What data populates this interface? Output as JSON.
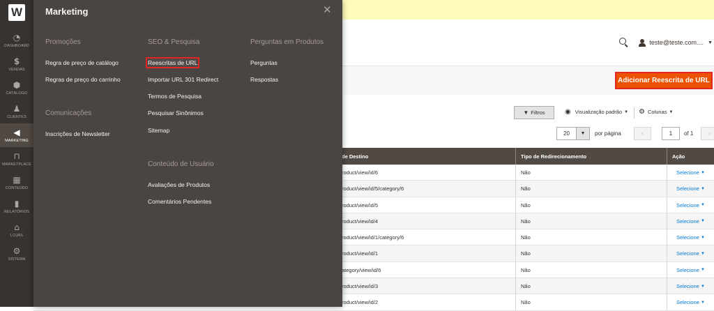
{
  "rail": {
    "items": [
      {
        "label": "DASHBOARD",
        "icon": "dashboard-icon"
      },
      {
        "label": "VENDAS",
        "icon": "dollar-icon"
      },
      {
        "label": "CATÁLOGO",
        "icon": "box-icon"
      },
      {
        "label": "CLIENTES",
        "icon": "person-icon"
      },
      {
        "label": "MARKETING",
        "icon": "megaphone-icon"
      },
      {
        "label": "MARKETPLACE",
        "icon": "store-icon"
      },
      {
        "label": "CONTEÚDO",
        "icon": "layout-icon"
      },
      {
        "label": "RELATÓRIOS",
        "icon": "bar-chart-icon"
      },
      {
        "label": "LOJAS",
        "icon": "storefront-icon"
      },
      {
        "label": "SISTEMA",
        "icon": "gear-icon"
      }
    ],
    "logo": "W",
    "active_index": 4
  },
  "flyout": {
    "title": "Marketing",
    "groups": [
      {
        "title": "Promoções",
        "links": [
          "Regra de preço de catálogo",
          "Regras de preço do carrinho"
        ]
      },
      {
        "title": "Comunicações",
        "links": [
          "Inscrições de Newsletter"
        ]
      },
      {
        "title": "SEO & Pesquisa",
        "links": [
          "Reescritas de URL",
          "Importar URL 301 Redirect",
          "Termos de Pesquisa",
          "Pesquisar Sinônimos",
          "Sitemap"
        ]
      },
      {
        "title": "Conteúdo de Usuário",
        "links": [
          "Avaliações de Produtos",
          "Comentários Pendentes"
        ]
      },
      {
        "title": "Perguntas em Produtos",
        "links": [
          "Perguntas",
          "Respostas"
        ]
      }
    ]
  },
  "header": {
    "user": "teste@teste.com...."
  },
  "actions": {
    "add_button": "Adicionar Reescrita de URL"
  },
  "toolbar": {
    "filters": "Filtros",
    "view": "Visualização padrão",
    "columns": "Colunas"
  },
  "pager": {
    "per_page_value": "20",
    "per_page_label": "por página",
    "current_page": "1",
    "of_pages": "of 1"
  },
  "grid": {
    "columns": [
      "de Destino",
      "Tipo de Redirecionamento",
      "Ação"
    ],
    "rows": [
      [
        "roduct/view/id/6",
        "Não",
        "Selecione"
      ],
      [
        "roduct/view/id/5/category/6",
        "Não",
        "Selecione"
      ],
      [
        "roduct/view/id/5",
        "Não",
        "Selecione"
      ],
      [
        "roduct/view/id/4",
        "Não",
        "Selecione"
      ],
      [
        "roduct/view/id/1/category/6",
        "Não",
        "Selecione"
      ],
      [
        "roduct/view/id/1",
        "Não",
        "Selecione"
      ],
      [
        "ategory/view/id/6",
        "Não",
        "Selecione"
      ],
      [
        "roduct/view/id/3",
        "Não",
        "Selecione"
      ],
      [
        "roduct/view/id/2",
        "Não",
        "Selecione"
      ]
    ]
  },
  "colors": {
    "rail_bg": "#373330",
    "flyout_bg": "#4a4542",
    "accent": "#eb5202",
    "link": "#007bdb",
    "notice": "#fffbbb"
  }
}
